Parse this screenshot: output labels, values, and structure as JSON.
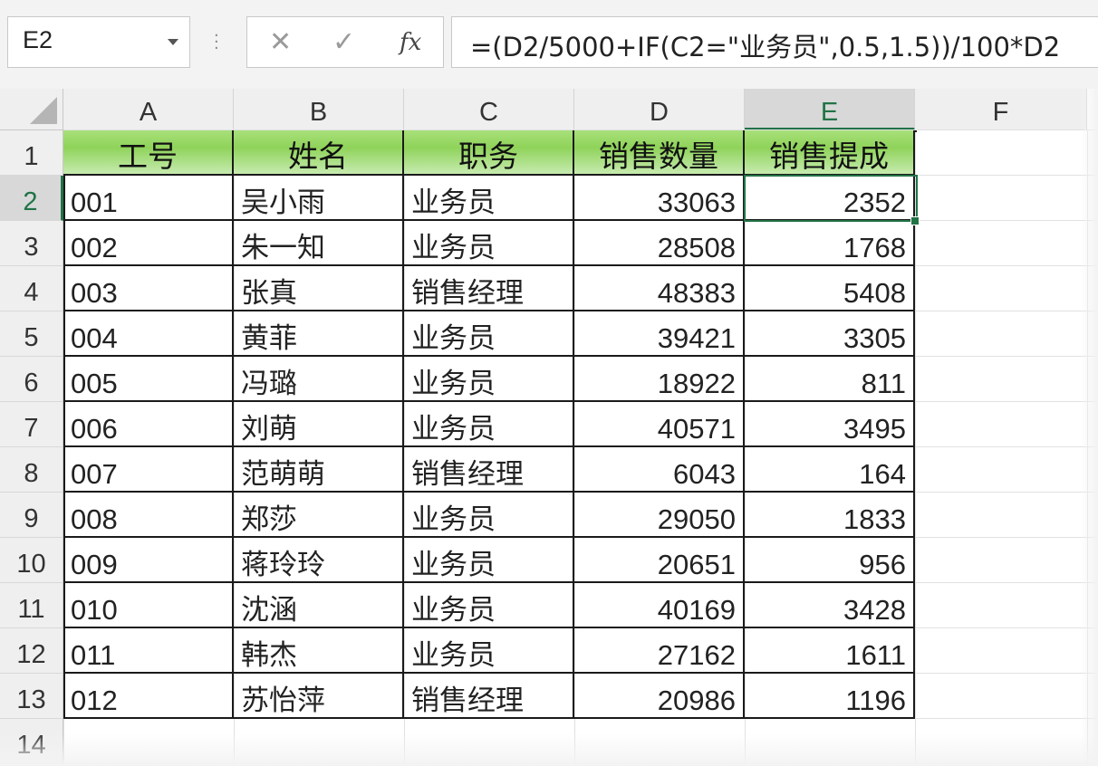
{
  "formula_bar": {
    "name_box": "E2",
    "cancel_symbol": "✕",
    "enter_symbol": "✓",
    "fx_symbol": "fx",
    "formula": "=(D2/5000+IF(C2=\"业务员\",0.5,1.5))/100*D2"
  },
  "columns": [
    "A",
    "B",
    "C",
    "D",
    "E",
    "F"
  ],
  "rows": [
    "1",
    "2",
    "3",
    "4",
    "5",
    "6",
    "7",
    "8",
    "9",
    "10",
    "11",
    "12",
    "13",
    "14"
  ],
  "active_cell": {
    "column": "E",
    "row": "2"
  },
  "table": {
    "headers": [
      "工号",
      "姓名",
      "职务",
      "销售数量",
      "销售提成"
    ],
    "records": [
      [
        "001",
        "吴小雨",
        "业务员",
        "33063",
        "2352"
      ],
      [
        "002",
        "朱一知",
        "业务员",
        "28508",
        "1768"
      ],
      [
        "003",
        "张真",
        "销售经理",
        "48383",
        "5408"
      ],
      [
        "004",
        "黄菲",
        "业务员",
        "39421",
        "3305"
      ],
      [
        "005",
        "冯璐",
        "业务员",
        "18922",
        "811"
      ],
      [
        "006",
        "刘萌",
        "业务员",
        "40571",
        "3495"
      ],
      [
        "007",
        "范萌萌",
        "销售经理",
        "6043",
        "164"
      ],
      [
        "008",
        "郑莎",
        "业务员",
        "29050",
        "1833"
      ],
      [
        "009",
        "蒋玲玲",
        "业务员",
        "20651",
        "956"
      ],
      [
        "010",
        "沈涵",
        "业务员",
        "40169",
        "3428"
      ],
      [
        "011",
        "韩杰",
        "业务员",
        "27162",
        "1611"
      ],
      [
        "012",
        "苏怡萍",
        "销售经理",
        "20986",
        "1196"
      ]
    ]
  },
  "colors": {
    "header_green": "#8fd35a",
    "selection_green": "#217346"
  }
}
